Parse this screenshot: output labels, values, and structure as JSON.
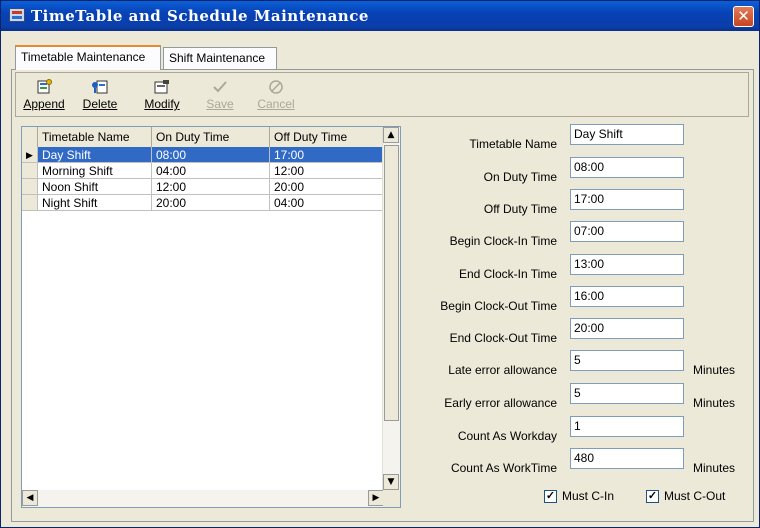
{
  "window": {
    "title": "TimeTable and Schedule Maintenance",
    "close_label": "✕"
  },
  "tabs": [
    {
      "label": "Timetable Maintenance",
      "active": true
    },
    {
      "label": "Shift Maintenance",
      "active": false
    }
  ],
  "toolbar": {
    "append": {
      "label": "Append",
      "icon": "append-icon"
    },
    "delete": {
      "label": "Delete",
      "icon": "delete-icon"
    },
    "modify": {
      "label": "Modify",
      "icon": "modify-icon"
    },
    "save": {
      "label": "Save",
      "icon": "checkmark-icon",
      "disabled": true
    },
    "cancel": {
      "label": "Cancel",
      "icon": "cancel-icon",
      "disabled": true
    }
  },
  "grid": {
    "columns": [
      "Timetable Name",
      "On Duty Time",
      "Off Duty Time"
    ],
    "rows": [
      {
        "name": "Day Shift",
        "on": "08:00",
        "off": "17:00",
        "selected": true
      },
      {
        "name": "Morning Shift",
        "on": "04:00",
        "off": "12:00",
        "selected": false
      },
      {
        "name": "Noon Shift",
        "on": "12:00",
        "off": "20:00",
        "selected": false
      },
      {
        "name": "Night Shift",
        "on": "20:00",
        "off": "04:00",
        "selected": false
      }
    ]
  },
  "form": {
    "timetable_name": {
      "label": "Timetable Name",
      "value": "Day Shift"
    },
    "on_duty": {
      "label": "On Duty Time",
      "value": "08:00"
    },
    "off_duty": {
      "label": "Off Duty Time",
      "value": "17:00"
    },
    "begin_in": {
      "label": "Begin Clock-In Time",
      "value": "07:00"
    },
    "end_in": {
      "label": "End Clock-In Time",
      "value": "13:00"
    },
    "begin_out": {
      "label": "Begin Clock-Out Time",
      "value": "16:00"
    },
    "end_out": {
      "label": "End Clock-Out Time",
      "value": "20:00"
    },
    "late_allow": {
      "label": "Late error allowance",
      "value": "5",
      "unit": "Minutes"
    },
    "early_allow": {
      "label": "Early error allowance",
      "value": "5",
      "unit": "Minutes"
    },
    "workday": {
      "label": "Count As Workday",
      "value": "1"
    },
    "worktime": {
      "label": "Count As WorkTime",
      "value": "480",
      "unit": "Minutes"
    },
    "must_cin": {
      "label": "Must C-In",
      "checked": true
    },
    "must_cout": {
      "label": "Must C-Out",
      "checked": true
    }
  }
}
